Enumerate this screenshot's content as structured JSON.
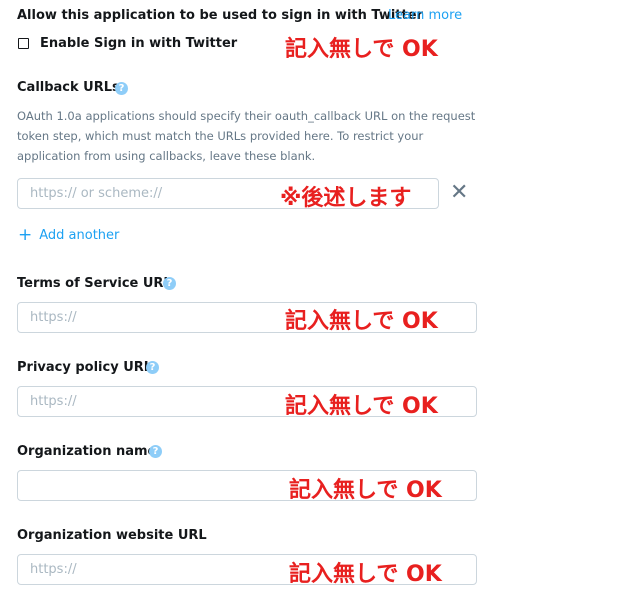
{
  "signin": {
    "title": "Allow this application to be used to sign in with Twitter",
    "learn_more": "Learn more",
    "checkbox_label": "Enable Sign in with Twitter",
    "checkbox_checked": false,
    "annotation": "記入無しで OK"
  },
  "callback": {
    "label": "Callback URLs",
    "help_icon": "help-question-icon",
    "description": "OAuth 1.0a applications should specify their oauth_callback URL on the request token step, which must match the URLs provided here. To restrict your application from using callbacks, leave these blank.",
    "input_value": "",
    "input_placeholder": "https:// or scheme://",
    "annotation": "※後述します",
    "remove_icon": "close-x-icon",
    "remove_glyph": "✕",
    "add_plus": "+",
    "add_another": "Add another"
  },
  "fields": {
    "terms": {
      "label": "Terms of Service URL",
      "has_help": true,
      "value": "",
      "placeholder": "https://",
      "annotation": "記入無しで OK"
    },
    "privacy": {
      "label": "Privacy policy URL",
      "has_help": true,
      "value": "",
      "placeholder": "https://",
      "annotation": "記入無しで OK"
    },
    "org_name": {
      "label": "Organization name",
      "has_help": true,
      "value": "",
      "placeholder": "",
      "annotation": "記入無しで OK"
    },
    "org_url": {
      "label": "Organization website URL",
      "has_help": false,
      "value": "",
      "placeholder": "https://",
      "annotation": "記入無しで OK"
    }
  },
  "help_glyph": "?",
  "colors": {
    "text": "#14171a",
    "link": "#1da1f2",
    "muted": "#657786",
    "input_border": "#ccd6dd",
    "placeholder": "#aab8c2",
    "help_icon_bg": "#8ecdf8",
    "annotation": "#e8201f"
  }
}
